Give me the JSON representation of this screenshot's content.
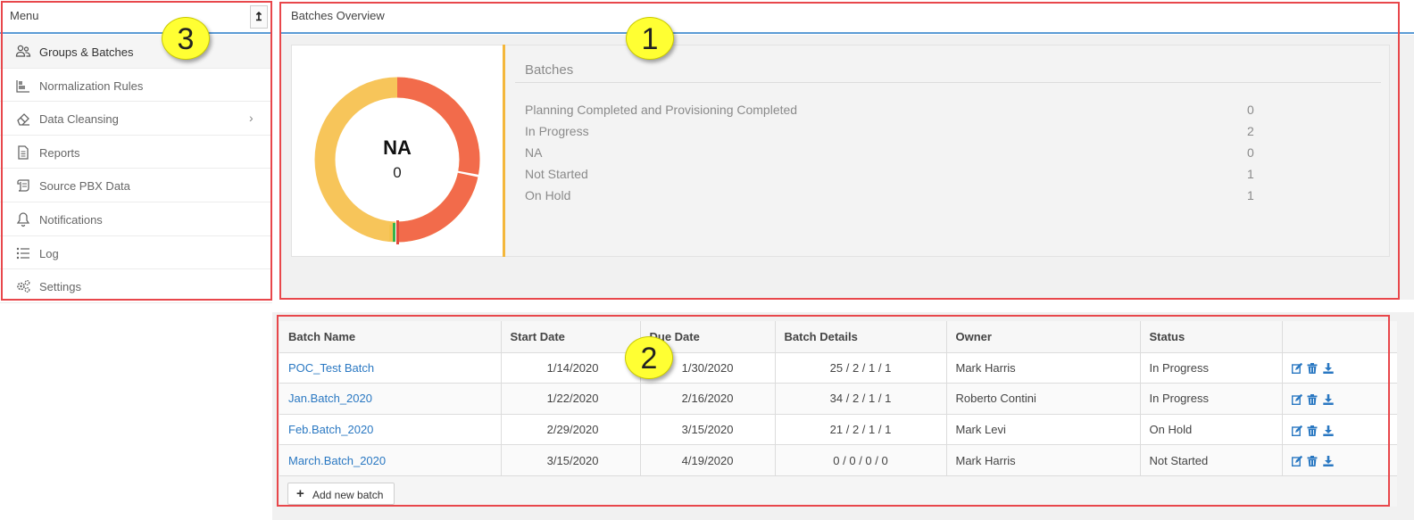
{
  "sidebar": {
    "title": "Menu",
    "pin_icon": "↥",
    "items": [
      {
        "label": "Groups & Batches",
        "icon": "users-icon",
        "active": true
      },
      {
        "label": "Normalization Rules",
        "icon": "bar-chart-icon"
      },
      {
        "label": "Data Cleansing",
        "icon": "eraser-icon",
        "has_submenu": true
      },
      {
        "label": "Reports",
        "icon": "document-icon"
      },
      {
        "label": "Source PBX Data",
        "icon": "scroll-icon"
      },
      {
        "label": "Notifications",
        "icon": "bell-icon"
      },
      {
        "label": "Log",
        "icon": "list-icon"
      },
      {
        "label": "Settings",
        "icon": "gears-icon"
      }
    ]
  },
  "overview": {
    "title": "Batches Overview",
    "donut": {
      "center_label": "NA",
      "center_value": "0",
      "segments": [
        {
          "name": "In Progress",
          "value": 2,
          "color": "#f26b4b"
        },
        {
          "name": "Not Started",
          "value": 1,
          "color": "#f7c55a"
        },
        {
          "name": "On Hold",
          "value": 1,
          "color": "#f26b4b"
        }
      ],
      "minor_marks": [
        "#e14b3c",
        "#35b24a",
        "#f4c24e"
      ]
    },
    "stats_title": "Batches",
    "stats": [
      {
        "label": "Planning Completed and Provisioning Completed",
        "value": "0"
      },
      {
        "label": "In Progress",
        "value": "2"
      },
      {
        "label": "NA",
        "value": "0"
      },
      {
        "label": "Not Started",
        "value": "1"
      },
      {
        "label": "On Hold",
        "value": "1"
      }
    ],
    "accent_color": "#f4b73b"
  },
  "batches_table": {
    "columns": [
      "Batch Name",
      "Start Date",
      "Due Date",
      "Batch Details",
      "Owner",
      "Status",
      ""
    ],
    "rows": [
      {
        "name": "POC_Test Batch",
        "start": "1/14/2020",
        "due": "1/30/2020",
        "details": "25 / 2 / 1 / 1",
        "owner": "Mark Harris",
        "status": "In Progress"
      },
      {
        "name": "Jan.Batch_2020",
        "start": "1/22/2020",
        "due": "2/16/2020",
        "details": "34 / 2 / 1 / 1",
        "owner": "Roberto Contini",
        "status": "In Progress"
      },
      {
        "name": "Feb.Batch_2020",
        "start": "2/29/2020",
        "due": "3/15/2020",
        "details": "21 / 2 / 1 / 1",
        "owner": "Mark Levi",
        "status": "On Hold"
      },
      {
        "name": "March.Batch_2020",
        "start": "3/15/2020",
        "due": "4/19/2020",
        "details": "0 / 0 / 0 / 0",
        "owner": "Mark Harris",
        "status": "Not Started"
      }
    ],
    "row_actions": [
      "edit-icon",
      "delete-icon",
      "download-icon"
    ],
    "add_button_label": "Add new batch",
    "link_color": "#2a78c2"
  },
  "annotations": {
    "callouts": [
      {
        "number": "1",
        "target": "batches-overview"
      },
      {
        "number": "2",
        "target": "batches-table"
      },
      {
        "number": "3",
        "target": "menu"
      }
    ],
    "highlight_color": "#e8474b",
    "callout_color": "#ffff33"
  }
}
